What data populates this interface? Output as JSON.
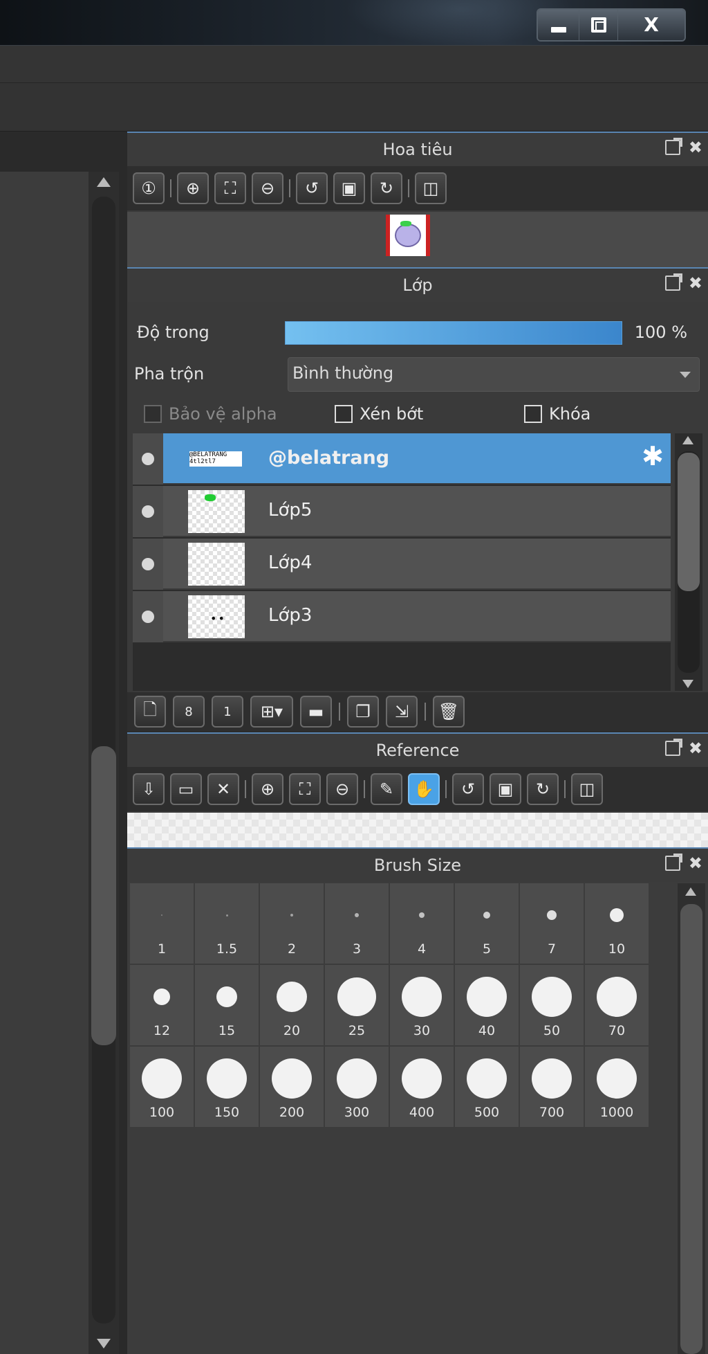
{
  "navigator": {
    "title": "Hoa tiêu"
  },
  "layers": {
    "title": "Lớp",
    "opacity_label": "Độ trong",
    "opacity_value": "100 %",
    "opacity_fraction": 1.0,
    "blend_label": "Pha trộn",
    "blend_value": "Bình thường",
    "protect_alpha_label": "Bảo vệ alpha",
    "clipping_label": "Xén bớt",
    "lock_label": "Khóa",
    "items": [
      {
        "name": "@belatrang",
        "selected": true
      },
      {
        "name": "Lớp5",
        "selected": false
      },
      {
        "name": "Lớp4",
        "selected": false
      },
      {
        "name": "Lớp3",
        "selected": false
      }
    ],
    "watermark_thumb_text": "@BELATRANG\n4tl2tl7"
  },
  "reference": {
    "title": "Reference"
  },
  "brush_size": {
    "title": "Brush Size",
    "sizes": [
      "1",
      "1.5",
      "2",
      "3",
      "4",
      "5",
      "7",
      "10",
      "12",
      "15",
      "20",
      "25",
      "30",
      "40",
      "50",
      "70",
      "100",
      "150",
      "200",
      "300",
      "400",
      "500",
      "700",
      "1000"
    ]
  },
  "colors": {
    "accent": "#4f97d3",
    "panel_border": "#5a86b3",
    "opacity_start": "#74c0f0",
    "opacity_end": "#3b86cc"
  }
}
